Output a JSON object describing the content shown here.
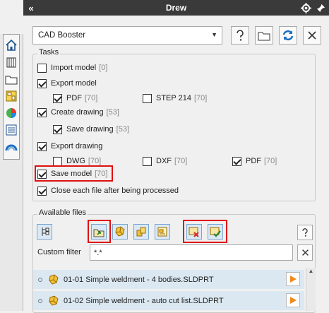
{
  "titlebar": {
    "collapse": "«",
    "title": "Drew"
  },
  "toolbar": {
    "selected_tool": "CAD Booster"
  },
  "tasks": {
    "legend": "Tasks",
    "import_model": {
      "label": "Import model",
      "count": "[0]",
      "checked": false
    },
    "export_model": {
      "label": "Export model",
      "checked": true
    },
    "pdf": {
      "label": "PDF",
      "count": "[70]",
      "checked": true
    },
    "step214": {
      "label": "STEP 214",
      "count": "[70]",
      "checked": false
    },
    "create_drawing": {
      "label": "Create drawing",
      "count": "[53]",
      "checked": true
    },
    "save_drawing": {
      "label": "Save drawing",
      "count": "[53]",
      "checked": true
    },
    "export_drawing": {
      "label": "Export drawing",
      "checked": true
    },
    "dwg": {
      "label": "DWG",
      "count": "[70]",
      "checked": false
    },
    "dxf": {
      "label": "DXF",
      "count": "[70]",
      "checked": false
    },
    "pdf2": {
      "label": "PDF",
      "count": "[70]",
      "checked": true
    },
    "save_model": {
      "label": "Save model",
      "count": "[70]",
      "checked": true
    },
    "close_each": {
      "label": "Close each file after being processed",
      "checked": true
    }
  },
  "files": {
    "legend": "Available files",
    "filter_label": "Custom filter",
    "filter_value": "*.*",
    "items": [
      {
        "name": "01-01 Simple weldment - 4 bodies.SLDPRT"
      },
      {
        "name": "01-02 Simple weldment - auto cut list.SLDPRT"
      }
    ]
  },
  "colors": {
    "highlight": "#e01010",
    "accent_blue": "#1a6fc4",
    "play_orange": "#f08a1c"
  }
}
